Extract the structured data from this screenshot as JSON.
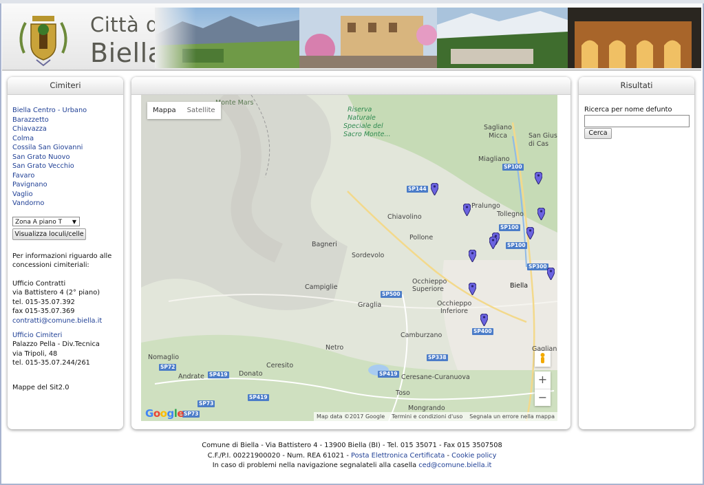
{
  "header": {
    "title_line1": "Città di",
    "title_line2": "Biella",
    "crest_icon": "city-crest-icon"
  },
  "left_panel": {
    "title": "Cimiteri",
    "cemeteries": [
      "Biella Centro - Urbano",
      "Barazzetto",
      "Chiavazza",
      "Colma",
      "Cossila San Giovanni",
      "San Grato Nuovo",
      "San Grato Vecchio",
      "Favaro",
      "Pavignano",
      "Vaglio",
      "Vandorno"
    ],
    "zone_select_value": "Zona A piano T",
    "show_button": "Visualizza loculi/celle",
    "info_intro_1": "Per informazioni riguardo alle",
    "info_intro_2": "concessioni cimiteriali:",
    "contratti": {
      "name": "Ufficio Contratti",
      "address": "via Battistero 4 (2° piano)",
      "tel": "tel. 015-35.07.392",
      "fax": "fax 015-35.07.369",
      "email": "contratti@comune.biella.it"
    },
    "cimiteri": {
      "name": "Ufficio Cimiteri",
      "building": "Palazzo Pella - Div.Tecnica",
      "address": "via Tripoli, 48",
      "tel": "tel. 015-35.07.244/261"
    },
    "sit_link": "Mappe del Sit2.0"
  },
  "map": {
    "tab_map": "Mappa",
    "tab_satellite": "Satellite",
    "zoom_in": "+",
    "zoom_out": "−",
    "google_logo": "Google",
    "attrib_data": "Map data ©2017 Google",
    "attrib_terms": "Termini e condizioni d'uso",
    "attrib_report": "Segnala un errore nella mappa",
    "places": [
      "Monte Mars",
      "Riserva",
      "Naturale",
      "Speciale del",
      "Sacro Monte...",
      "Sagliano",
      "Micca",
      "San Gius",
      "di Cas",
      "Miagliano",
      "Chiavolino",
      "Pollone",
      "Tollegno",
      "Bagneri",
      "Sordevolo",
      "Campiglie",
      "Occhieppo",
      "Superiore",
      "Graglia",
      "Biella",
      "Occhieppo",
      "Inferiore",
      "Camburzano",
      "Netro",
      "Nomaglio",
      "Ceresito",
      "Andrate",
      "Donato",
      "Ceresane-Curanuova",
      "Toso",
      "Mongrando",
      "Pralungo",
      "Gaglian"
    ],
    "roads": [
      "SP100",
      "SP144",
      "SP100",
      "SP100",
      "SP300",
      "SP500",
      "SP400",
      "SP338",
      "SP419",
      "SP73",
      "SP72",
      "SP419",
      "SP419",
      "SP73"
    ]
  },
  "right_panel": {
    "title": "Risultati",
    "search_label": "Ricerca per nome defunto",
    "search_value": "",
    "search_button": "Cerca"
  },
  "footer": {
    "line1": "Comune di Biella - Via Battistero 4 - 13900 Biella (BI) - Tel. 015 35071 - Fax 015 3507508",
    "line2_prefix": "C.F./P.I. 00221900020 - Num. REA 61021 - ",
    "line2_pec": "Posta Elettronica Certificata",
    "line2_sep": " - ",
    "line2_cookie": "Cookie policy",
    "line3_prefix": "In caso di problemi nella navigazione segnalateli alla casella ",
    "line3_email": "ced@comune.biella.it"
  }
}
